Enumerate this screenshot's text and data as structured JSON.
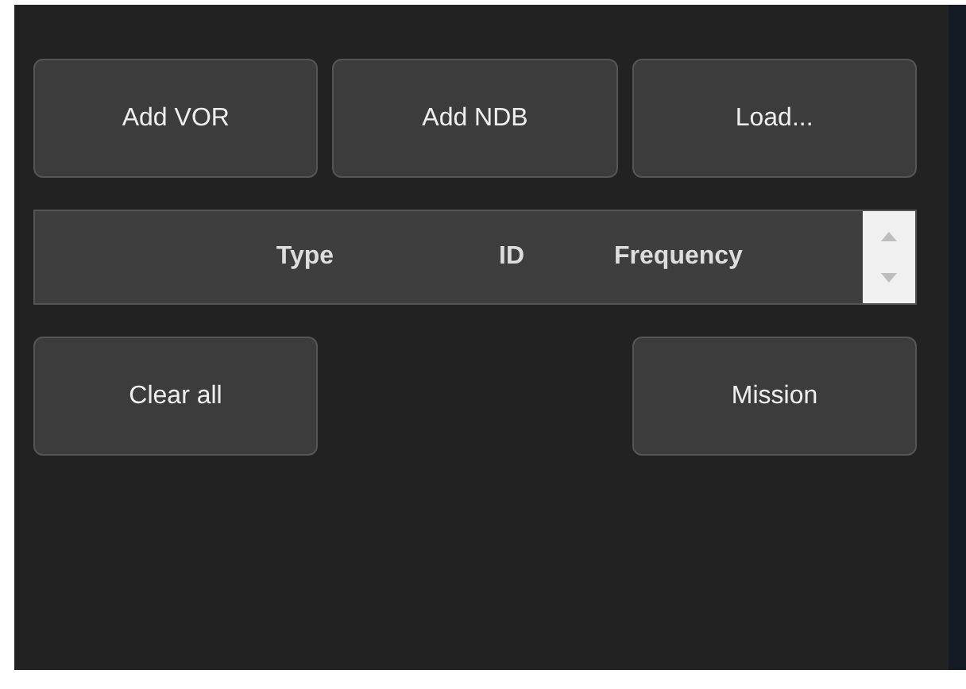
{
  "top_buttons": [
    "Add VOR",
    "Add NDB",
    "Load..."
  ],
  "table": {
    "columns": [
      "Type",
      "ID",
      "Frequency"
    ]
  },
  "bottom_buttons": [
    "Clear all",
    "Mission"
  ]
}
